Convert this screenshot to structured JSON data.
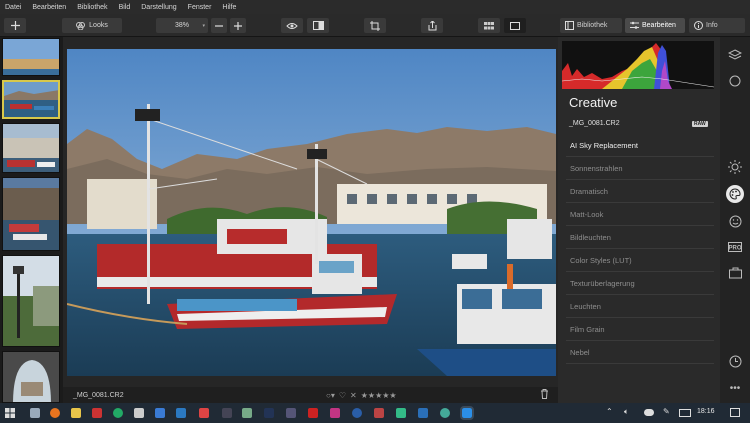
{
  "menu": [
    "Datei",
    "Bearbeiten",
    "Bibliothek",
    "Bild",
    "Darstellung",
    "Fenster",
    "Hilfe"
  ],
  "toolbar": {
    "looks_label": "Looks",
    "zoom_value": "38%",
    "tab_library": "Bibliothek",
    "tab_edit": "Bearbeiten",
    "tab_info": "Info"
  },
  "viewer": {
    "filename": "_MG_0081.CR2",
    "rating_stars": "★★★★★"
  },
  "panel": {
    "title": "Creative",
    "file": "_MG_0081.CR2",
    "raw_badge": "RAW",
    "items": [
      "AI Sky Replacement",
      "Sonnenstrahlen",
      "Dramatisch",
      "Matt-Look",
      "Bildleuchten",
      "Color Styles (LUT)",
      "Texturüberlagerung",
      "Leuchten",
      "Film Grain",
      "Nebel"
    ]
  },
  "taskbar": {
    "time": "18:16"
  },
  "colors": {
    "accent_thumb": "#d8c84a",
    "panel_bg": "#2a2a2a"
  }
}
